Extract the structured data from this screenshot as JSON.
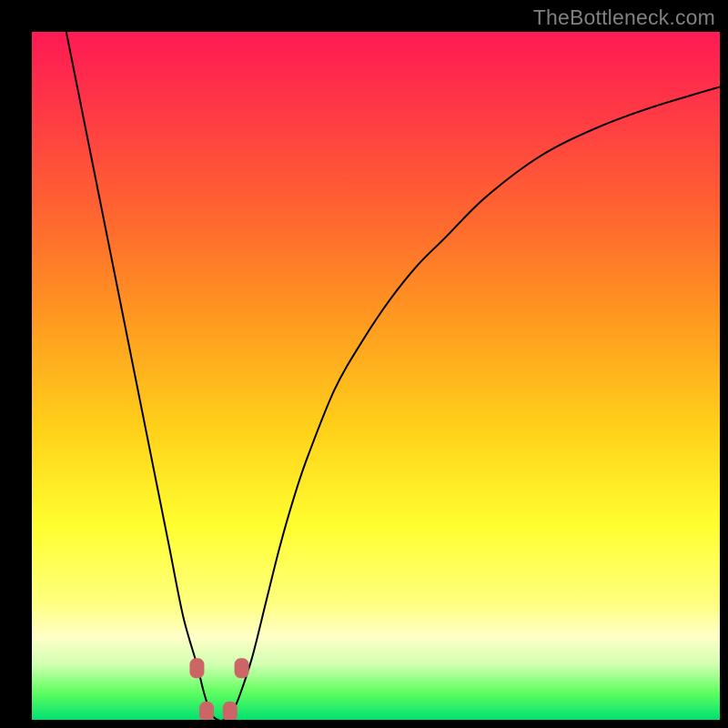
{
  "watermark": {
    "text": "TheBottleneck.com"
  },
  "chart_data": {
    "type": "line",
    "title": "",
    "xlabel": "",
    "ylabel": "",
    "xlim": [
      0,
      100
    ],
    "ylim": [
      0,
      100
    ],
    "grid": false,
    "series": [
      {
        "name": "curve",
        "x": [
          5,
          7,
          10,
          12,
          15,
          18,
          20,
          22,
          24,
          25,
          26,
          27,
          28,
          29,
          30,
          32,
          34,
          36,
          38,
          40,
          44,
          48,
          52,
          56,
          60,
          66,
          74,
          82,
          90,
          100
        ],
        "y": [
          100,
          90,
          75,
          65,
          50,
          35,
          25,
          15,
          8,
          4,
          1,
          0,
          0,
          1,
          3,
          9,
          17,
          25,
          32,
          38,
          48,
          55,
          61,
          66,
          70,
          76,
          82,
          86,
          89,
          92
        ]
      }
    ],
    "markers": [
      {
        "x": 24.0,
        "y": 7.5
      },
      {
        "x": 25.4,
        "y": 1.2
      },
      {
        "x": 28.8,
        "y": 1.2
      },
      {
        "x": 30.5,
        "y": 7.5
      }
    ],
    "background_gradient": {
      "top": "#ff1a55",
      "bottom": "#00e070"
    }
  }
}
